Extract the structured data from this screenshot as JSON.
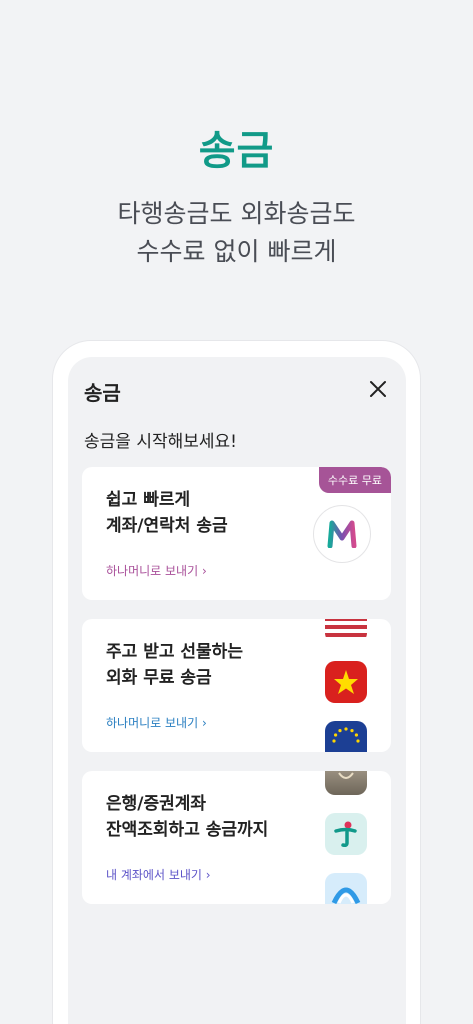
{
  "hero": {
    "title": "송금",
    "subtitle_line1": "타행송금도 외화송금도",
    "subtitle_line2": "수수료 없이 빠르게"
  },
  "modal": {
    "title": "송금",
    "lead": "송금을 시작해보세요!"
  },
  "cards": [
    {
      "line1": "쉽고 빠르게",
      "line2": "계좌/연락처 송금",
      "link": "하나머니로 보내기 ›",
      "badge": "수수료 무료",
      "link_color": "#a9509a"
    },
    {
      "line1": "주고 받고 선물하는",
      "line2": "외화 무료 송금",
      "link": "하나머니로 보내기 ›",
      "link_color": "#2a7fc1",
      "icons": [
        "us-flag-icon",
        "vietnam-flag-icon",
        "eu-flag-icon"
      ]
    },
    {
      "line1": "은행/증권계좌",
      "line2": "잔액조회하고 송금까지",
      "link": "내 계좌에서 보내기 ›",
      "link_color": "#5d54c8",
      "icons": [
        "bank-app-icon",
        "hana-bank-icon",
        "bank-blue-icon"
      ]
    }
  ],
  "colors": {
    "accent": "#119a88",
    "badge": "#a65497"
  }
}
